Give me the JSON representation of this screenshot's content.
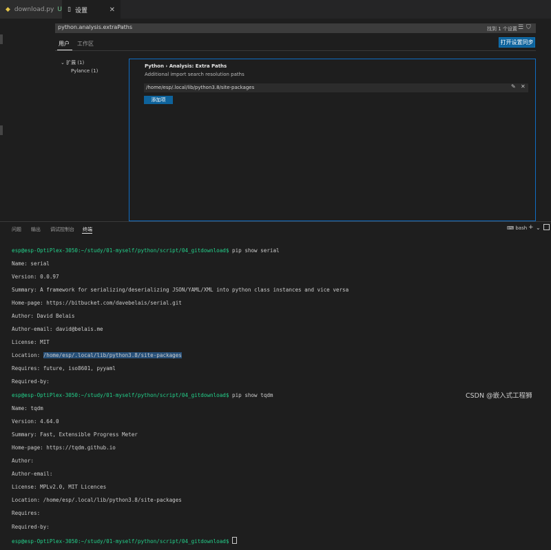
{
  "tabs": [
    {
      "label": "download.py",
      "modified": "U",
      "icon": "python-file-icon"
    },
    {
      "label": "设置",
      "icon": "file-icon"
    }
  ],
  "search": {
    "value": "python.analysis.extraPaths",
    "result_count": "找到 1 个设置"
  },
  "scopes": [
    "用户",
    "工作区"
  ],
  "sync_button": "打开设置同步",
  "tree": {
    "group": "扩展 (1)",
    "item": "Pylance (1)"
  },
  "setting": {
    "title_prefix": "Python › Analysis: ",
    "title_name": "Extra Paths",
    "description": "Additional import search resolution paths",
    "paths": [
      "/home/esp/.local/lib/python3.8/site-packages"
    ],
    "add_label": "添加项"
  },
  "panel_tabs": [
    "问题",
    "输出",
    "调试控制台",
    "终端"
  ],
  "terminal": {
    "shell": "bash",
    "prompt": "esp@esp-OptiPlex-3050:~/study/01-myself/python/script/04_gitdownload$",
    "cmd1": " pip show serial",
    "block1": [
      "Name: serial",
      "Version: 0.0.97",
      "Summary: A framework for serializing/deserializing JSON/YAML/XML into python class instances and vice versa",
      "Home-page: https://bitbucket.com/davebelais/serial.git",
      "Author: David Belais",
      "Author-email: david@belais.me",
      "License: MIT"
    ],
    "location_label": "Location: ",
    "location_value": "/home/esp/.local/lib/python3.8/site-packages",
    "block1b": [
      "Requires: future, iso8601, pyyaml",
      "Required-by:"
    ],
    "cmd2": " pip show tqdm",
    "block2": [
      "Name: tqdm",
      "Version: 4.64.0",
      "Summary: Fast, Extensible Progress Meter",
      "Home-page: https://tqdm.github.io",
      "Author:",
      "Author-email:",
      "License: MPLv2.0, MIT Licences",
      "Location: /home/esp/.local/lib/python3.8/site-packages",
      "Requires:",
      "Required-by:"
    ]
  },
  "watermark": "CSDN @嵌入式工程狮",
  "colors": {
    "accent": "#0e639c",
    "focus_border": "#0f6ec6",
    "prompt": "#23d18b",
    "selection": "#264f78"
  }
}
